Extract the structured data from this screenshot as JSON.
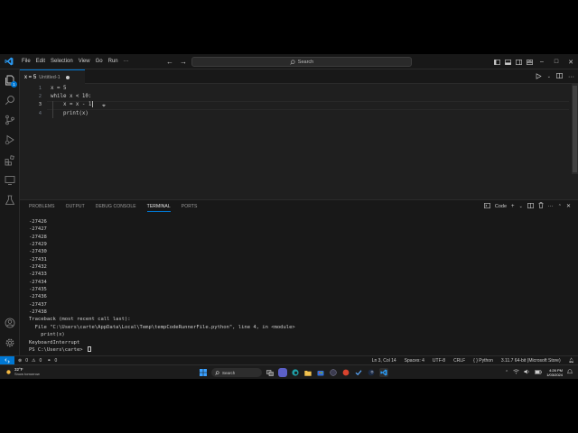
{
  "window": {
    "menu": [
      "File",
      "Edit",
      "Selection",
      "View",
      "Go",
      "Run",
      "···"
    ],
    "search_label": "Search"
  },
  "activity_badge": "1",
  "tab": {
    "name": "x = 5",
    "subtitle": "Untitled-1"
  },
  "editor": {
    "line_numbers": [
      "1",
      "2",
      "3",
      "4"
    ],
    "lines": [
      "x = 5",
      "while x < 10:",
      "    x = x - 1",
      "    print(x)"
    ]
  },
  "panel": {
    "tabs": [
      "PROBLEMS",
      "OUTPUT",
      "DEBUG CONSOLE",
      "TERMINAL",
      "PORTS"
    ],
    "active_tab": "TERMINAL",
    "terminal_profile": "Code"
  },
  "terminal": {
    "lines": [
      "-27426",
      "-27427",
      "-27428",
      "-27429",
      "-27430",
      "-27431",
      "-27432",
      "-27433",
      "-27434",
      "-27435",
      "-27436",
      "-27437",
      "-27438",
      "Traceback (most recent call last):",
      "  File \"C:\\Users\\carte\\AppData\\Local\\Temp\\tempCodeRunnerFile.python\", line 4, in <module>",
      "    print(x)",
      "KeyboardInterrupt"
    ],
    "prompt": "PS C:\\Users\\carte> "
  },
  "status": {
    "errors": "0",
    "warnings": "0",
    "ports": "0",
    "position": "Ln 3, Col 14",
    "spaces": "Spaces: 4",
    "encoding": "UTF-8",
    "eol": "CRLF",
    "language": "Python",
    "interpreter": "3.11.7 64-bit (Microsoft Store)"
  },
  "taskbar": {
    "weather_temp": "32°F",
    "weather_desc": "Snow tomorrow",
    "search_label": "Search",
    "time": "4:26 PM",
    "date": "1/03/2024"
  },
  "colors": {
    "accent": "#0078d4",
    "editor_bg": "#1f1f1f",
    "chrome_bg": "#181818"
  }
}
